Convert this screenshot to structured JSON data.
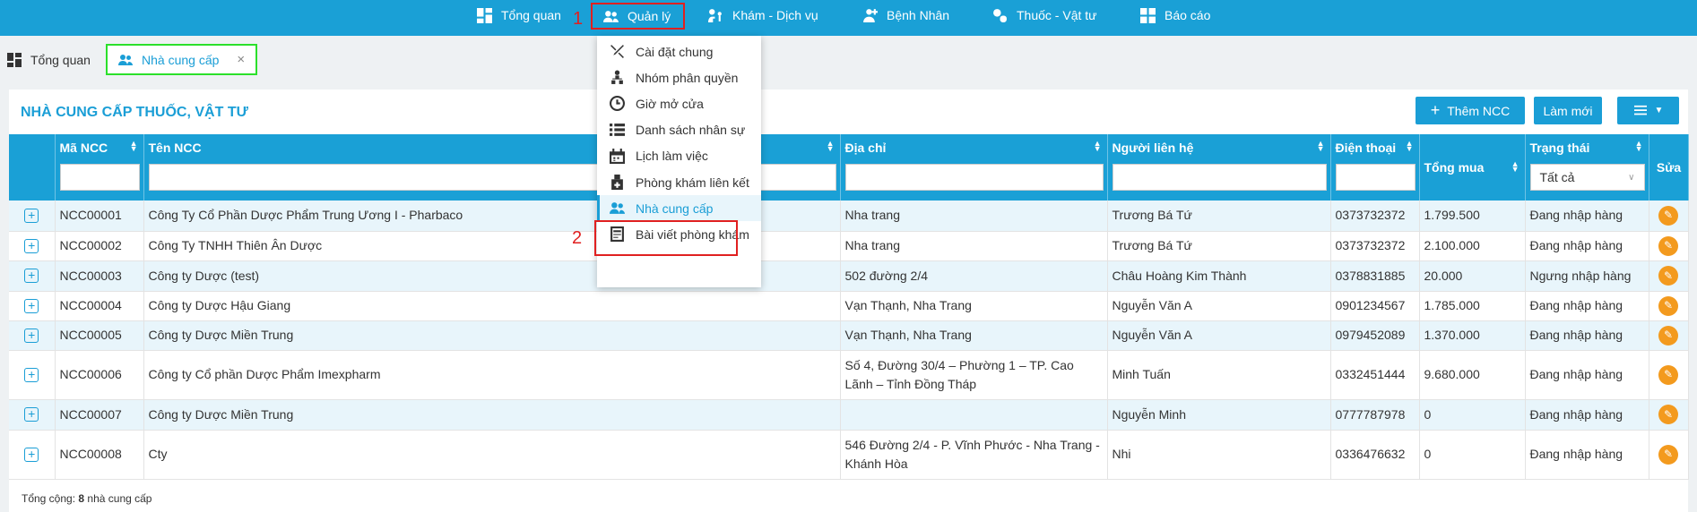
{
  "topnav": {
    "items": [
      {
        "label": "Tổng quan",
        "icon": "dashboard-icon"
      },
      {
        "label": "Quản lý",
        "icon": "users-icon"
      },
      {
        "label": "Khám - Dịch vụ",
        "icon": "stethoscope-icon"
      },
      {
        "label": "Bệnh Nhân",
        "icon": "patient-icon"
      },
      {
        "label": "Thuốc - Vật tư",
        "icon": "pill-icon"
      },
      {
        "label": "Báo cáo",
        "icon": "report-icon"
      }
    ],
    "annotation_1": "1",
    "annotation_2": "2"
  },
  "tabs": [
    {
      "label": "Tổng quan",
      "icon": "dashboard-icon"
    },
    {
      "label": "Nhà cung cấp",
      "icon": "users-icon",
      "close": "×"
    }
  ],
  "panel": {
    "title": "NHÀ CUNG CẤP THUỐC, VẬT TƯ",
    "add_button": "Thêm NCC",
    "refresh_button": "Làm mới"
  },
  "table": {
    "headers": [
      "Mã NCC",
      "Tên NCC",
      "Địa chỉ",
      "Người liên hệ",
      "Điện thoại",
      "Tổng mua",
      "Trạng thái",
      "Sửa"
    ],
    "status_filter": "Tất cả",
    "rows": [
      {
        "code": "NCC00001",
        "name": "Công Ty Cổ Phần Dược Phẩm Trung Ương I - Pharbaco",
        "address": "Nha trang",
        "contact": "Trương Bá Tứ",
        "phone": "0373732372",
        "total": "1.799.500",
        "status": "Đang nhập hàng"
      },
      {
        "code": "NCC00002",
        "name": "Công Ty TNHH Thiên Ân Dược",
        "address": "Nha trang",
        "contact": "Trương Bá Tứ",
        "phone": "0373732372",
        "total": "2.100.000",
        "status": "Đang nhập hàng"
      },
      {
        "code": "NCC00003",
        "name": "Công ty Dược (test)",
        "address": "502 đường 2/4",
        "contact": "Châu Hoàng Kim Thành",
        "phone": "0378831885",
        "total": "20.000",
        "status": "Ngưng nhập hàng"
      },
      {
        "code": "NCC00004",
        "name": "Công ty Dược Hậu Giang",
        "address": "Vạn Thạnh, Nha Trang",
        "contact": "Nguyễn Văn A",
        "phone": "0901234567",
        "total": "1.785.000",
        "status": "Đang nhập hàng"
      },
      {
        "code": "NCC00005",
        "name": "Công ty Dược Miền Trung",
        "address": "Vạn Thạnh, Nha Trang",
        "contact": "Nguyễn Văn A",
        "phone": "0979452089",
        "total": "1.370.000",
        "status": "Đang nhập hàng"
      },
      {
        "code": "NCC00006",
        "name": "Công ty Cổ phần Dược Phẩm Imexpharm",
        "address": "Số 4, Đường 30/4 – Phường 1 – TP. Cao Lãnh – Tỉnh Đồng Tháp",
        "contact": "Minh Tuấn",
        "phone": "0332451444",
        "total": "9.680.000",
        "status": "Đang nhập hàng"
      },
      {
        "code": "NCC00007",
        "name": "Công ty Dược Miền Trung",
        "address": "",
        "contact": "Nguyễn Minh",
        "phone": "0777787978",
        "total": "0",
        "status": "Đang nhập hàng"
      },
      {
        "code": "NCC00008",
        "name": "Cty",
        "address": "546 Đường 2/4 - P. Vĩnh Phước - Nha Trang - Khánh Hòa",
        "contact": "Nhi",
        "phone": "0336476632",
        "total": "0",
        "status": "Đang nhập hàng"
      }
    ]
  },
  "footer": {
    "label": "Tổng cộng:",
    "count": "8",
    "suffix": "nhà cung cấp"
  },
  "menu": {
    "items": [
      {
        "label": "Cài đặt chung",
        "icon": "tools-icon"
      },
      {
        "label": "Nhóm phân quyền",
        "icon": "org-icon"
      },
      {
        "label": "Giờ mở cửa",
        "icon": "clock-icon"
      },
      {
        "label": "Danh sách nhân sự",
        "icon": "list-icon"
      },
      {
        "label": "Lịch làm việc",
        "icon": "calendar-icon"
      },
      {
        "label": "Phòng khám liên kết",
        "icon": "clinic-icon"
      },
      {
        "label": "Nhà cung cấp",
        "icon": "users-icon"
      },
      {
        "label": "Bài viết phòng khám",
        "icon": "article-icon"
      }
    ]
  },
  "colors": {
    "primary": "#1aa0d6",
    "accent": "#f39a1e",
    "highlight_red": "#e02020",
    "highlight_green": "#2be02b"
  }
}
